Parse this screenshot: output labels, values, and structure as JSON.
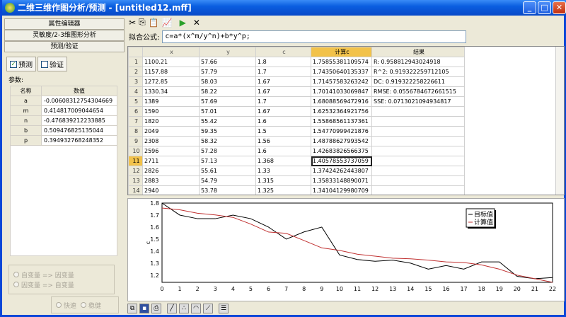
{
  "window": {
    "title": "二维三维作图分析/预测 - [untitled12.mff]"
  },
  "left": {
    "nav": [
      "属性编辑器",
      "灵敏度/2-3维图形分析",
      "预测/验证"
    ],
    "tabs": [
      {
        "label": "预测",
        "checked": true
      },
      {
        "label": "验证",
        "checked": false
      }
    ],
    "params_label": "参数:",
    "params_headers": [
      "名称",
      "数值"
    ],
    "params": [
      [
        "a",
        "-0.00608312754304669"
      ],
      [
        "m",
        "0.414817009044654"
      ],
      [
        "n",
        "-0.476839212233885"
      ],
      [
        "b",
        "0.509476825135044"
      ],
      [
        "p",
        "0.394932768248352"
      ]
    ],
    "direction": [
      "自变量 => 因变量",
      "因变量 => 自变量"
    ],
    "mode": [
      "快速",
      "稳健"
    ]
  },
  "toolbar": {
    "icons": [
      "cut-icon",
      "copy-icon",
      "paste-icon",
      "chart-icon",
      "run-icon",
      "delete-icon"
    ]
  },
  "formula": {
    "label": "拟合公式:",
    "value": "c=a*(x^m/y^n)+b*y^p;"
  },
  "grid": {
    "headers": [
      "x",
      "y",
      "c",
      "计算c",
      "结果"
    ],
    "rows": [
      [
        "1",
        "1100.21",
        "57.66",
        "1.8",
        "1.75855381109574",
        "R: 0.958812943024918"
      ],
      [
        "2",
        "1157.88",
        "57.79",
        "1.7",
        "1.74350640135337",
        "R^2: 0.919322259712105"
      ],
      [
        "3",
        "1272.85",
        "58.03",
        "1.67",
        "1.71457583263242",
        "DC: 0.919322258226611"
      ],
      [
        "4",
        "1330.34",
        "58.22",
        "1.67",
        "1.70141033069847",
        "RMSE: 0.0556784672661515"
      ],
      [
        "5",
        "1389",
        "57.69",
        "1.7",
        "1.68088569472916",
        "SSE: 0.0713021094934817"
      ],
      [
        "6",
        "1590",
        "57.01",
        "1.67",
        "1.62532364921756",
        ""
      ],
      [
        "7",
        "1820",
        "55.42",
        "1.6",
        "1.55868561137361",
        ""
      ],
      [
        "8",
        "2049",
        "59.35",
        "1.5",
        "1.54770999421876",
        ""
      ],
      [
        "9",
        "2308",
        "58.32",
        "1.56",
        "1.48788627993542",
        ""
      ],
      [
        "10",
        "2596",
        "57.28",
        "1.6",
        "1.42683826566375",
        ""
      ],
      [
        "11",
        "2711",
        "57.13",
        "1.368",
        "1.40578553737059",
        ""
      ],
      [
        "12",
        "2826",
        "55.61",
        "1.33",
        "1.37424262443807",
        ""
      ],
      [
        "13",
        "2883",
        "54.79",
        "1.315",
        "1.35833148890071",
        ""
      ],
      [
        "14",
        "2940",
        "53.78",
        "1.325",
        "1.34104129980709",
        ""
      ]
    ]
  },
  "chart_data": {
    "type": "line",
    "ylabel": "c",
    "xlim": [
      0,
      22
    ],
    "ylim": [
      1.14,
      1.8
    ],
    "xticks": [
      0,
      1,
      2,
      3,
      4,
      5,
      6,
      7,
      8,
      9,
      10,
      11,
      12,
      13,
      14,
      15,
      16,
      17,
      18,
      19,
      20,
      21,
      22
    ],
    "yticks": [
      1.2,
      1.3,
      1.4,
      1.5,
      1.6,
      1.7,
      1.8
    ],
    "legend_position": "top-right",
    "series": [
      {
        "name": "目标值",
        "color": "#000000",
        "values": [
          1.8,
          1.7,
          1.67,
          1.67,
          1.7,
          1.67,
          1.6,
          1.5,
          1.56,
          1.6,
          1.368,
          1.33,
          1.315,
          1.325,
          1.3,
          1.25,
          1.28,
          1.25,
          1.31,
          1.31,
          1.19,
          1.17,
          1.18
        ]
      },
      {
        "name": "计算值",
        "color": "#c03030",
        "values": [
          1.759,
          1.744,
          1.715,
          1.701,
          1.681,
          1.625,
          1.559,
          1.548,
          1.488,
          1.427,
          1.406,
          1.374,
          1.358,
          1.341,
          1.336,
          1.325,
          1.31,
          1.305,
          1.285,
          1.25,
          1.2,
          1.17,
          1.14
        ]
      }
    ]
  },
  "bottom_toolbar": {
    "icons": [
      "copy-chart-icon",
      "save-icon",
      "print-icon",
      "line-chart-icon",
      "scatter-chart-icon",
      "area-chart-icon",
      "fit-chart-icon",
      "legend-icon"
    ]
  }
}
